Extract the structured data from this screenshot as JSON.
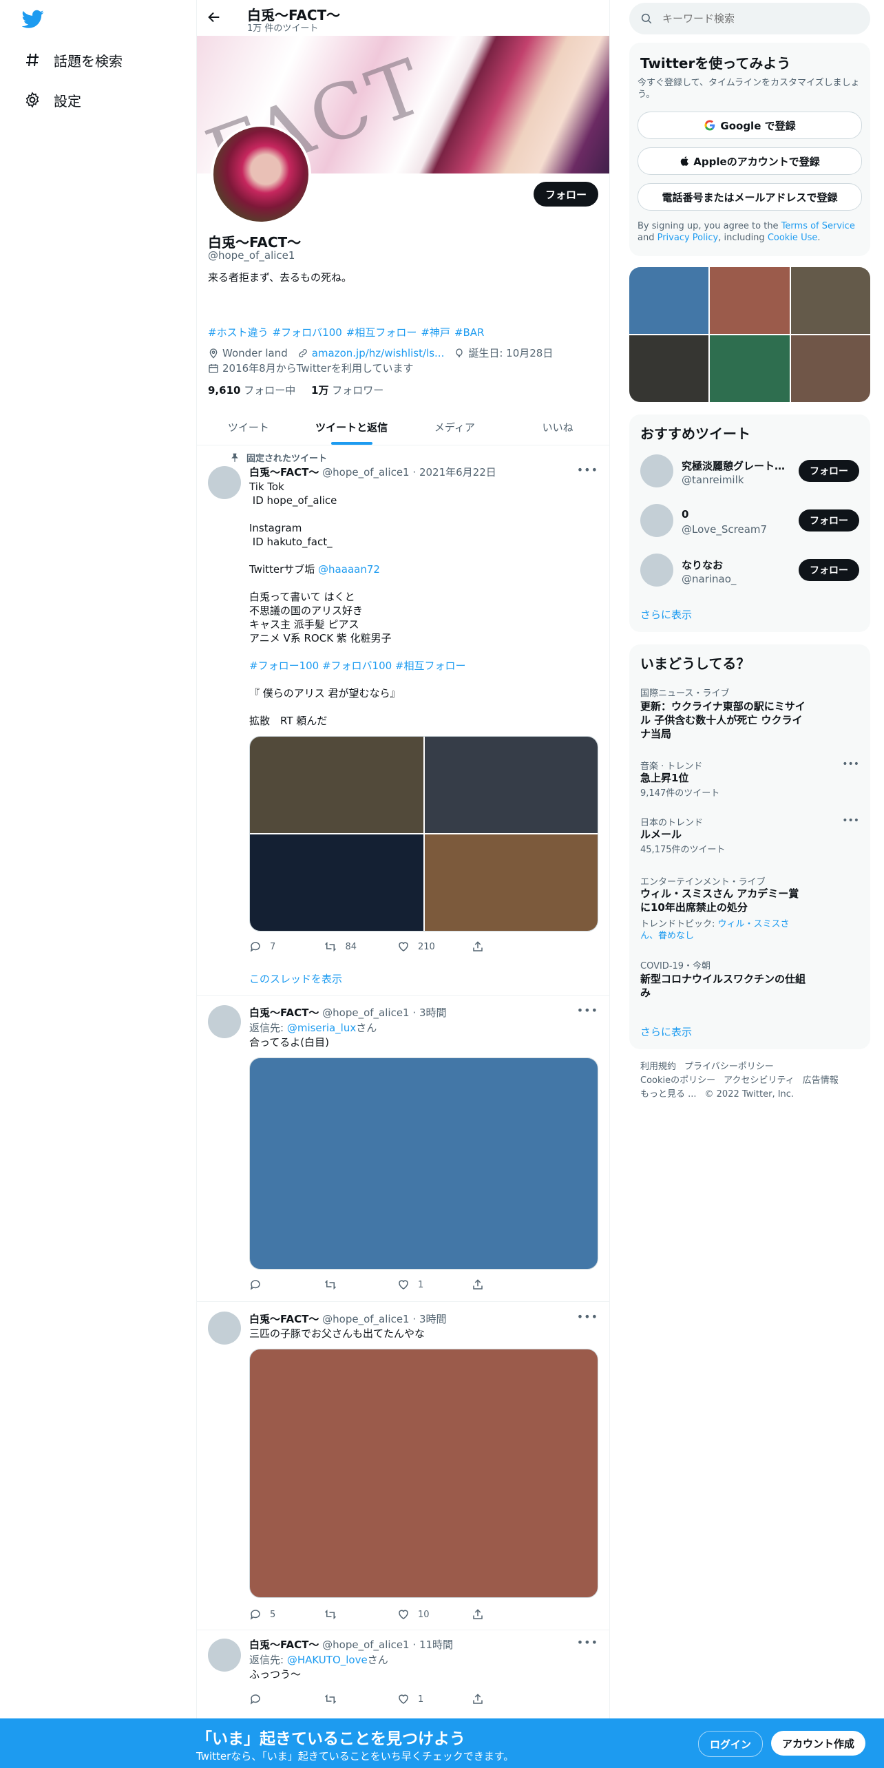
{
  "nav": {
    "explore_label": "話題を検索",
    "settings_label": "設定"
  },
  "header": {
    "name": "白兎〜FACT〜",
    "tweet_count": "1万 件のツイート"
  },
  "profile": {
    "banner_text": "FACT",
    "follow_label": "フォロー",
    "name": "白兎〜FACT〜",
    "handle": "@hope_of_alice1",
    "bio": "来る者拒まず、去るもの死ね。",
    "hashtags": [
      "#ホスト違う",
      "#フォロバ100",
      "#相互フォロー",
      "#神戸",
      "#BAR"
    ],
    "location": "Wonder land",
    "link": "amazon.jp/hz/wishlist/ls...",
    "birthday": "誕生日: 10月28日",
    "joined": "2016年8月からTwitterを利用しています",
    "following_count": "9,610",
    "following_label": "フォロー中",
    "followers_count": "1万",
    "followers_label": "フォロワー"
  },
  "tabs": [
    "ツイート",
    "ツイートと返信",
    "メディア",
    "いいね"
  ],
  "active_tab": "ツイートと返信",
  "tweets": [
    {
      "pinned_label": "固定されたツイート",
      "name": "白兎〜FACT〜",
      "handle": "@hope_of_alice1",
      "time": "2021年6月22日",
      "lines": {
        "l1": "Tik Tok",
        "l2": " ID hope_of_alice",
        "l3": "Instagram",
        "l4": " ID hakuto_fact_",
        "l5a": "Twitterサブ垢 ",
        "l5b": "@haaaan72",
        "l6": "白兎って書いて はくと",
        "l7": "不思議の国のアリス好き",
        "l8": "キャス主 派手髪 ピアス",
        "l9": "アニメ V系 ROCK 紫 化粧男子",
        "l10": "#フォロー100 #フォロバ100 #相互フォロー",
        "l11": "『 僕らのアリス 君が望むなら』",
        "l12": "拡散　RT 頼んだ"
      },
      "media_colors": [
        "#524a3a",
        "#363d48",
        "#142033",
        "#7c5a3c"
      ],
      "replies": "7",
      "retweets": "84",
      "likes": "210",
      "thread_label": "このスレッドを表示"
    },
    {
      "name": "白兎〜FACT〜",
      "handle": "@hope_of_alice1",
      "time": "3時間",
      "reply_prefix": "返信先: ",
      "reply_to": "@miseria_lux",
      "reply_suffix": "さん",
      "text": "合ってるよ(白目)",
      "media_color": "#4377a7",
      "replies": "",
      "retweets": "",
      "likes": "1"
    },
    {
      "name": "白兎〜FACT〜",
      "handle": "@hope_of_alice1",
      "time": "3時間",
      "text": "三匹の子豚でお父さんも出てたんやな",
      "media_color": "#9b5b4b",
      "replies": "5",
      "retweets": "",
      "likes": "10"
    },
    {
      "name": "白兎〜FACT〜",
      "handle": "@hope_of_alice1",
      "time": "11時間",
      "reply_prefix": "返信先: ",
      "reply_to": "@HAKUTO_love",
      "reply_suffix": "さん",
      "text": "ふっつう〜",
      "replies": "",
      "retweets": "",
      "likes": "1"
    }
  ],
  "right": {
    "search_placeholder": "キーワード検索",
    "signup": {
      "title": "Twitterを使ってみよう",
      "subtitle": "今すぐ登録して、タイムラインをカスタマイズしましょう。",
      "google": "Google で登録",
      "apple": "Appleのアカウントで登録",
      "phone": "電話番号またはメールアドレスで登録",
      "terms_a": "By signing up, you agree to the ",
      "terms_b": "Terms of Service",
      "terms_c": " and ",
      "terms_d": "Privacy Policy",
      "terms_e": ", including ",
      "terms_f": "Cookie Use",
      "terms_g": "."
    },
    "media_grid_colors": [
      "#4377a7",
      "#9b5b4b",
      "#645a4a",
      "#363632",
      "#2e6e4f",
      "#705648"
    ],
    "recommend": {
      "title": "おすすめツイート",
      "users": [
        {
          "name": "究極淡麗憩グレート…",
          "handle": "@tanreimilk"
        },
        {
          "name": "0",
          "handle": "@Love_Scream7"
        },
        {
          "name": "なりなお",
          "handle": "@narinao_"
        }
      ],
      "follow_label": "フォロー",
      "show_more": "さらに表示"
    },
    "trends": {
      "title": "いまどうしてる？",
      "items": [
        {
          "category": "国際ニュース・ライブ",
          "title": "更新：ウクライナ東部の駅にミサイル 子供含む数十人が死亡 ウクライナ当局"
        },
        {
          "category": "音楽 · トレンド",
          "title": "急上昇1位",
          "count": "9,147件のツイート"
        },
        {
          "category": "日本のトレンド",
          "title": "ルメール",
          "count": "45,175件のツイート"
        },
        {
          "category": "エンターテインメント・ライブ",
          "title": "ウィル・スミスさん アカデミー賞に10年出席禁止の処分",
          "topic_prefix": "トレンドトピック: ",
          "topic_links": "ウィル・スミスさん、眷めなし"
        },
        {
          "category": "COVID-19・今朝",
          "title": "新型コロナウイルスワクチンの仕組み"
        }
      ],
      "show_more": "さらに表示"
    },
    "footer": {
      "terms": "利用規約",
      "privacy": "プライバシーポリシー",
      "cookie": "Cookieのポリシー",
      "accessibility": "アクセシビリティ",
      "ads": "広告情報",
      "more": "もっと見る ...",
      "copyright": "© 2022 Twitter, Inc."
    }
  },
  "bottom_bar": {
    "title": "「いま」起きていることを見つけよう",
    "subtitle": "Twitterなら、「いま」起きていることをいち早くチェックできます。",
    "login": "ログイン",
    "signup": "アカウント作成"
  }
}
